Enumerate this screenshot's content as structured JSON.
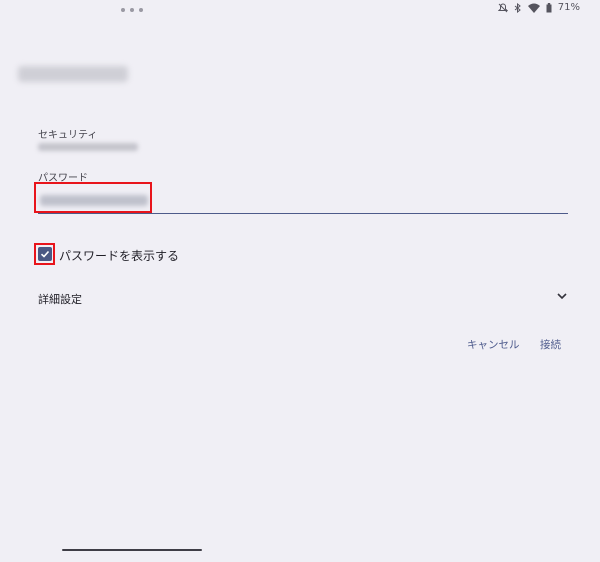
{
  "status_bar": {
    "battery": "71%",
    "icons": [
      "mute-icon",
      "bluetooth-icon",
      "wifi-icon",
      "battery-icon"
    ]
  },
  "form": {
    "network_name": "",
    "security_label": "セキュリティ",
    "security_value": "",
    "password_label": "パスワード",
    "password_value": "",
    "show_password_label": "パスワードを表示する",
    "show_password_checked": true,
    "advanced_label": "詳細設定"
  },
  "actions": {
    "cancel_label": "キャンセル",
    "connect_label": "接続"
  },
  "colors": {
    "background": "#f0eff5",
    "accent": "#4d5a8c",
    "highlight": "#e8141b"
  }
}
